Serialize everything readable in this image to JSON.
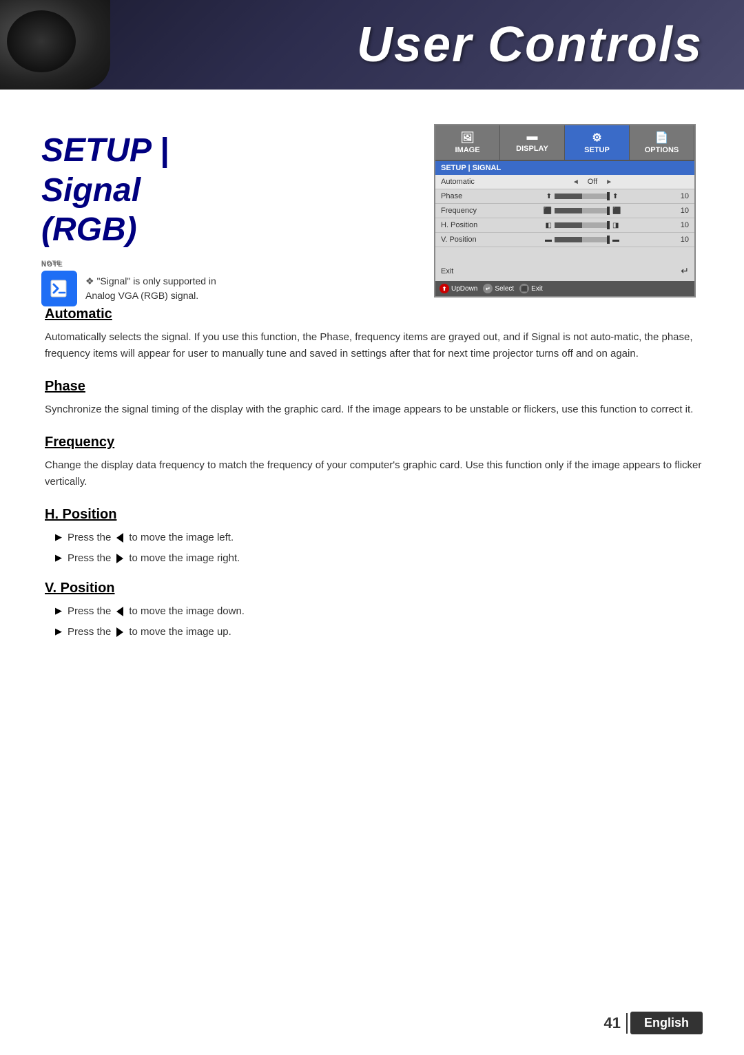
{
  "header": {
    "title": "User Controls"
  },
  "page": {
    "setup_title_line1": "SETUP | Signal",
    "setup_title_line2": "(RGB)"
  },
  "note": {
    "label": "NOTE",
    "text": "\"Signal\" is only supported in Analog VGA (RGB) signal."
  },
  "osd": {
    "tabs": [
      {
        "label": "IMAGE",
        "icon": "🖼"
      },
      {
        "label": "DISPLAY",
        "icon": "▬"
      },
      {
        "label": "SETUP",
        "icon": "⚙"
      },
      {
        "label": "OPTIONS",
        "icon": "📄"
      }
    ],
    "breadcrumb": "SETUP | SIGNAL",
    "rows": [
      {
        "label": "Automatic",
        "left_arrow": "◄",
        "value": "Off",
        "right_arrow": "►"
      },
      {
        "label": "Phase",
        "has_bar": true,
        "bar_value": "10"
      },
      {
        "label": "Frequency",
        "has_bar": true,
        "bar_value": "10"
      },
      {
        "label": "H. Position",
        "has_bar": true,
        "bar_value": "10"
      },
      {
        "label": "V. Position",
        "has_bar": true,
        "bar_value": "10"
      }
    ],
    "exit_label": "Exit",
    "footer": [
      {
        "btn_type": "red",
        "label": "UpDown"
      },
      {
        "btn_type": "gray",
        "label": "Select"
      },
      {
        "btn_type": "gray",
        "label": "Exit"
      }
    ]
  },
  "sections": {
    "automatic": {
      "heading": "Automatic",
      "body": "Automatically selects the signal. If you use this function, the Phase, frequency items are grayed out, and if Signal is not auto-matic, the phase, frequency items will appear for user to manually tune and saved in settings after that for next time projector turns off and on again."
    },
    "phase": {
      "heading": "Phase",
      "body": "Synchronize the signal timing of the display with the graphic card. If the image appears to be unstable or flickers, use this function to correct it."
    },
    "frequency": {
      "heading": "Frequency",
      "body": "Change the display data frequency to match the frequency of your computer's graphic card. Use this function only if the image appears to flicker vertically."
    },
    "h_position": {
      "heading": "H. Position",
      "bullets": [
        "Press the  to move the image left.",
        "Press the  to move the image right."
      ]
    },
    "v_position": {
      "heading": "V. Position",
      "bullets": [
        "Press the  to move the image down.",
        "Press the  to move the image up."
      ]
    }
  },
  "footer": {
    "page_number": "41",
    "language": "English"
  }
}
